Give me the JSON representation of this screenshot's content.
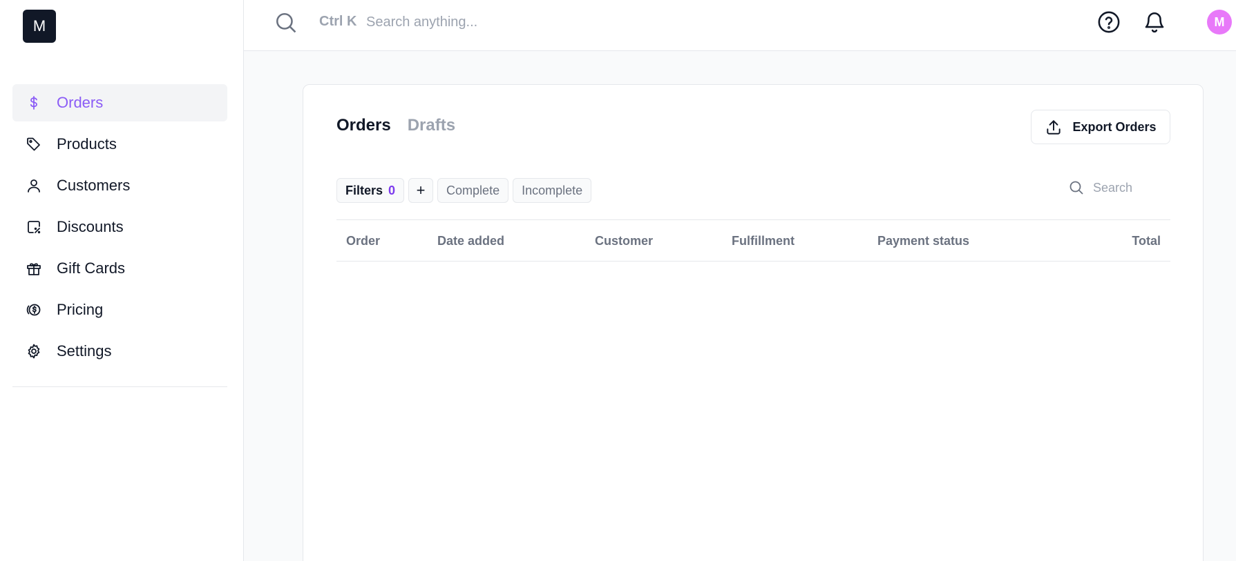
{
  "logo": {
    "letter": "M"
  },
  "sidebar": {
    "items": [
      {
        "label": "Orders",
        "icon": "dollar-icon",
        "active": true
      },
      {
        "label": "Products",
        "icon": "tag-icon"
      },
      {
        "label": "Customers",
        "icon": "user-icon"
      },
      {
        "label": "Discounts",
        "icon": "discount-icon"
      },
      {
        "label": "Gift Cards",
        "icon": "gift-icon"
      },
      {
        "label": "Pricing",
        "icon": "coins-icon"
      },
      {
        "label": "Settings",
        "icon": "gear-icon"
      }
    ]
  },
  "topbar": {
    "shortcut": "Ctrl K",
    "search_placeholder": "Search anything...",
    "avatar_letter": "M",
    "avatar_color": "#e879f9"
  },
  "orders": {
    "tabs": [
      {
        "label": "Orders",
        "active": true
      },
      {
        "label": "Drafts",
        "active": false
      }
    ],
    "export_label": "Export Orders",
    "filters_label": "Filters",
    "filters_count": "0",
    "add_filter_label": "+",
    "quick_filters": [
      "Complete",
      "Incomplete"
    ],
    "search_placeholder": "Search",
    "columns": [
      "Order",
      "Date added",
      "Customer",
      "Fulfillment",
      "Payment status",
      "Total"
    ]
  },
  "colors": {
    "accent": "#8b5cf6",
    "count": "#7c3aed",
    "logo_bg": "#111827"
  }
}
